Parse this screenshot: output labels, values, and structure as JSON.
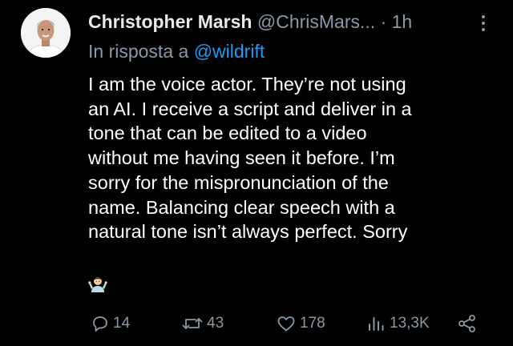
{
  "author": {
    "display_name": "Christopher Marsh",
    "handle": "@ChrisMars...",
    "separator": "·",
    "time": "1h"
  },
  "reply_context": {
    "prefix": "In risposta a",
    "handle": "@wildrift"
  },
  "tweet": {
    "lines": [
      "I am the voice actor.  They’re not using",
      "an AI.  I receive a script and deliver in a",
      "tone that can be edited to a video",
      "without me having seen it before.  I’m",
      "sorry for the mispronunciation of the",
      "name.  Balancing clear speech with a",
      "natural tone isn’t always perfect.  Sorry"
    ],
    "emoji": "man-shrugging-emoji"
  },
  "actions": {
    "replies": "14",
    "reposts": "43",
    "likes": "178",
    "views": "13,3K"
  },
  "colors": {
    "background": "#000000",
    "text": "#e7e9ea",
    "secondary": "#8b98a5",
    "link": "#1d9bf0"
  },
  "icons": [
    "avatar",
    "more-icon",
    "reply-icon",
    "repost-icon",
    "like-icon",
    "views-icon",
    "share-icon"
  ]
}
